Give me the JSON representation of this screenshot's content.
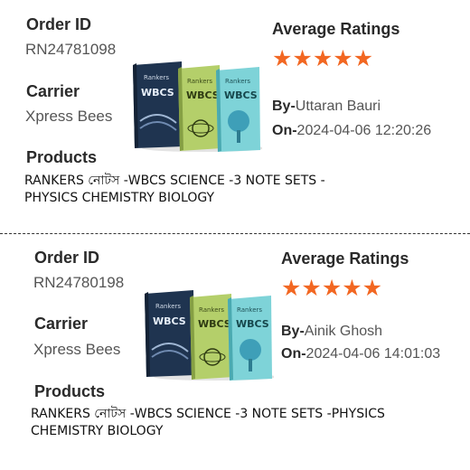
{
  "labels": {
    "order_id": "Order ID",
    "carrier": "Carrier",
    "products": "Products",
    "average_ratings": "Average Ratings",
    "by_prefix": "By-",
    "on_prefix": "On-"
  },
  "stars": "★★★★★",
  "rating_color": "#f26722",
  "orders": [
    {
      "order_id": "RN24781098",
      "carrier": "Xpress Bees",
      "reviewer": "Uttaran Bauri",
      "date": "2024-04-06 12:20:26",
      "rating": 5,
      "product": "RANKERS নোটস -WBCS SCIENCE -3 NOTE SETS -PHYSICS CHEMISTRY BIOLOGY",
      "product_line1": "RANKERS নোটস -WBCS SCIENCE -3 NOTE SETS -",
      "product_line2": "PHYSICS CHEMISTRY BIOLOGY",
      "book_titles": [
        "WBCS",
        "WBCS",
        "WBCS"
      ]
    },
    {
      "order_id": "RN24780198",
      "carrier": "Xpress Bees",
      "reviewer": "Ainik Ghosh",
      "date": "2024-04-06 14:01:03",
      "rating": 5,
      "product": "RANKERS নোটস -WBCS SCIENCE -3 NOTE SETS -PHYSICS CHEMISTRY BIOLOGY",
      "product_line1": "RANKERS নোটস -WBCS SCIENCE -3 NOTE SETS -PHYSICS",
      "product_line2": "CHEMISTRY BIOLOGY",
      "book_titles": [
        "WBCS",
        "WBCS",
        "WBCS"
      ]
    }
  ]
}
